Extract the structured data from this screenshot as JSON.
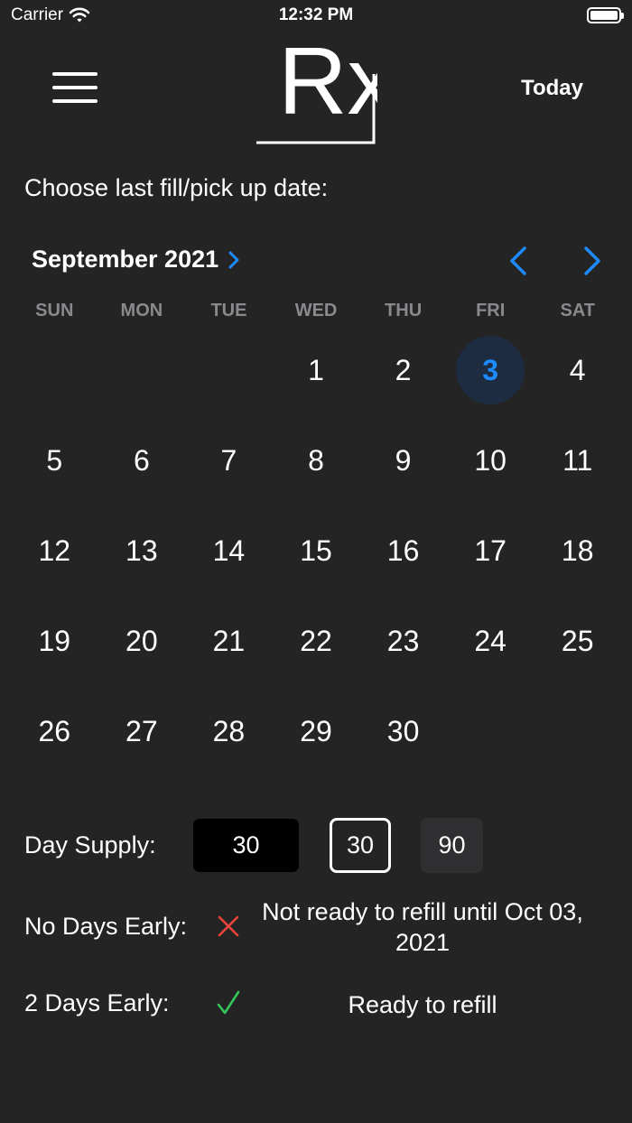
{
  "status_bar": {
    "carrier": "Carrier",
    "time": "12:32 PM"
  },
  "header": {
    "logo_text": "Rx",
    "today_label": "Today"
  },
  "prompt": "Choose last fill/pick up date:",
  "calendar": {
    "month_label": "September 2021",
    "weekdays": [
      "SUN",
      "MON",
      "TUE",
      "WED",
      "THU",
      "FRI",
      "SAT"
    ],
    "days": [
      "",
      "",
      "",
      "1",
      "2",
      "3",
      "4",
      "5",
      "6",
      "7",
      "8",
      "9",
      "10",
      "11",
      "12",
      "13",
      "14",
      "15",
      "16",
      "17",
      "18",
      "19",
      "20",
      "21",
      "22",
      "23",
      "24",
      "25",
      "26",
      "27",
      "28",
      "29",
      "30"
    ],
    "selected_day": "3",
    "accent_color": "#1e8bff"
  },
  "supply": {
    "label": "Day Supply:",
    "value_field": "30",
    "option_30": "30",
    "option_90": "90"
  },
  "no_days_early": {
    "label": "No Days Early:",
    "icon": "x-mark-icon",
    "icon_color": "#e8443a",
    "message": "Not ready to refill until  Oct 03, 2021"
  },
  "two_days_early": {
    "label": "2 Days Early:",
    "icon": "check-icon",
    "icon_color": "#34c759",
    "message": "Ready to refill"
  }
}
